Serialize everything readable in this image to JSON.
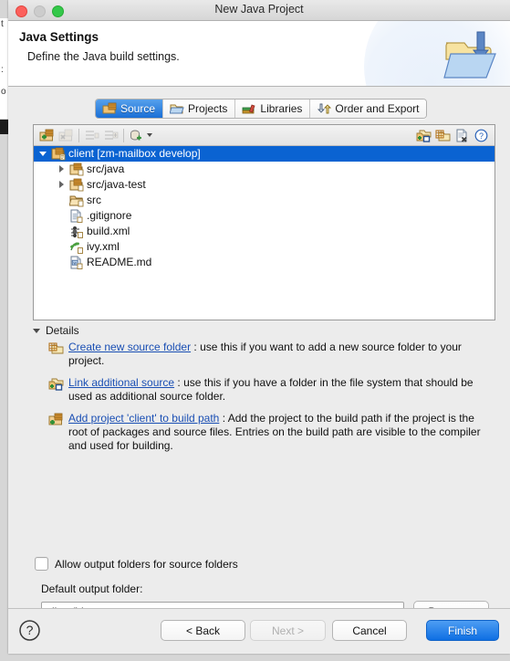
{
  "window": {
    "title": "New Java Project",
    "traffic_lights": [
      "close",
      "minimize",
      "maximize"
    ]
  },
  "header": {
    "title": "Java Settings",
    "subtitle": "Define the Java build settings.",
    "icon": "folder-import-icon"
  },
  "tabs": [
    {
      "label": "Source",
      "icon": "source-folder-icon",
      "active": true
    },
    {
      "label": "Projects",
      "icon": "projects-folder-icon",
      "active": false
    },
    {
      "label": "Libraries",
      "icon": "libraries-books-icon",
      "active": false
    },
    {
      "label": "Order and Export",
      "icon": "order-export-icon",
      "active": false
    }
  ],
  "tree_toolbar": {
    "buttons": [
      {
        "name": "add-source-folder-icon",
        "enabled": true
      },
      {
        "name": "remove-source-folder-icon",
        "enabled": false
      },
      {
        "name": "collapse-filter-icon",
        "enabled": false
      },
      {
        "name": "expand-filter-icon",
        "enabled": false
      },
      {
        "name": "configure-output-icon",
        "enabled": true
      }
    ],
    "right_buttons": [
      {
        "name": "link-source-icon",
        "enabled": true
      },
      {
        "name": "create-source-folder-icon",
        "enabled": true
      },
      {
        "name": "remove-entry-icon",
        "enabled": true
      },
      {
        "name": "help-icon",
        "enabled": true
      }
    ]
  },
  "tree": {
    "items": [
      {
        "label": "client [zm-mailbox develop]",
        "icon": "java-project-icon",
        "indent": 0,
        "twisty": "open",
        "selected": true
      },
      {
        "label": "src/java",
        "icon": "source-folder-icon",
        "indent": 1,
        "twisty": "closed",
        "selected": false
      },
      {
        "label": "src/java-test",
        "icon": "source-folder-icon",
        "indent": 1,
        "twisty": "closed",
        "selected": false
      },
      {
        "label": "src",
        "icon": "plain-folder-icon",
        "indent": 1,
        "twisty": "none",
        "selected": false
      },
      {
        "label": ".gitignore",
        "icon": "text-file-icon",
        "indent": 1,
        "twisty": "none",
        "selected": false
      },
      {
        "label": "build.xml",
        "icon": "ant-build-file-icon",
        "indent": 1,
        "twisty": "none",
        "selected": false
      },
      {
        "label": "ivy.xml",
        "icon": "ivy-file-icon",
        "indent": 1,
        "twisty": "none",
        "selected": false
      },
      {
        "label": "README.md",
        "icon": "markdown-file-icon",
        "indent": 1,
        "twisty": "none",
        "selected": false
      }
    ]
  },
  "details": {
    "header_label": "Details",
    "expanded": true,
    "entries": [
      {
        "icon": "create-source-folder-icon",
        "link": "Create new source folder",
        "text": " : use this if you want to add a new source folder to your project."
      },
      {
        "icon": "link-source-icon",
        "link": "Link additional source",
        "text": " : use this if you have a folder in the file system that should be used as additional source folder."
      },
      {
        "icon": "add-project-to-build-path-icon",
        "link": "Add project 'client' to build path",
        "text": " : Add the project to the build path if the project is the root of packages and source files. Entries on the build path are visible to the compiler and used for building."
      }
    ]
  },
  "options": {
    "allow_output_folders_label": "Allow output folders for source folders",
    "allow_output_folders_checked": false,
    "default_output_label": "Default output folder:",
    "default_output_value": "client/bin",
    "default_output_placeholder": "",
    "browse_label": "Browse..."
  },
  "footer": {
    "help_icon": "help-question-icon",
    "back_label": "< Back",
    "next_label": "Next >",
    "next_enabled": false,
    "cancel_label": "Cancel",
    "finish_label": "Finish"
  },
  "colors": {
    "selection_blue": "#0a63d2",
    "primary_button": "#0e6fe3",
    "link_blue": "#1a4fb4",
    "window_bg": "#ececec",
    "panel_white": "#ffffff"
  }
}
